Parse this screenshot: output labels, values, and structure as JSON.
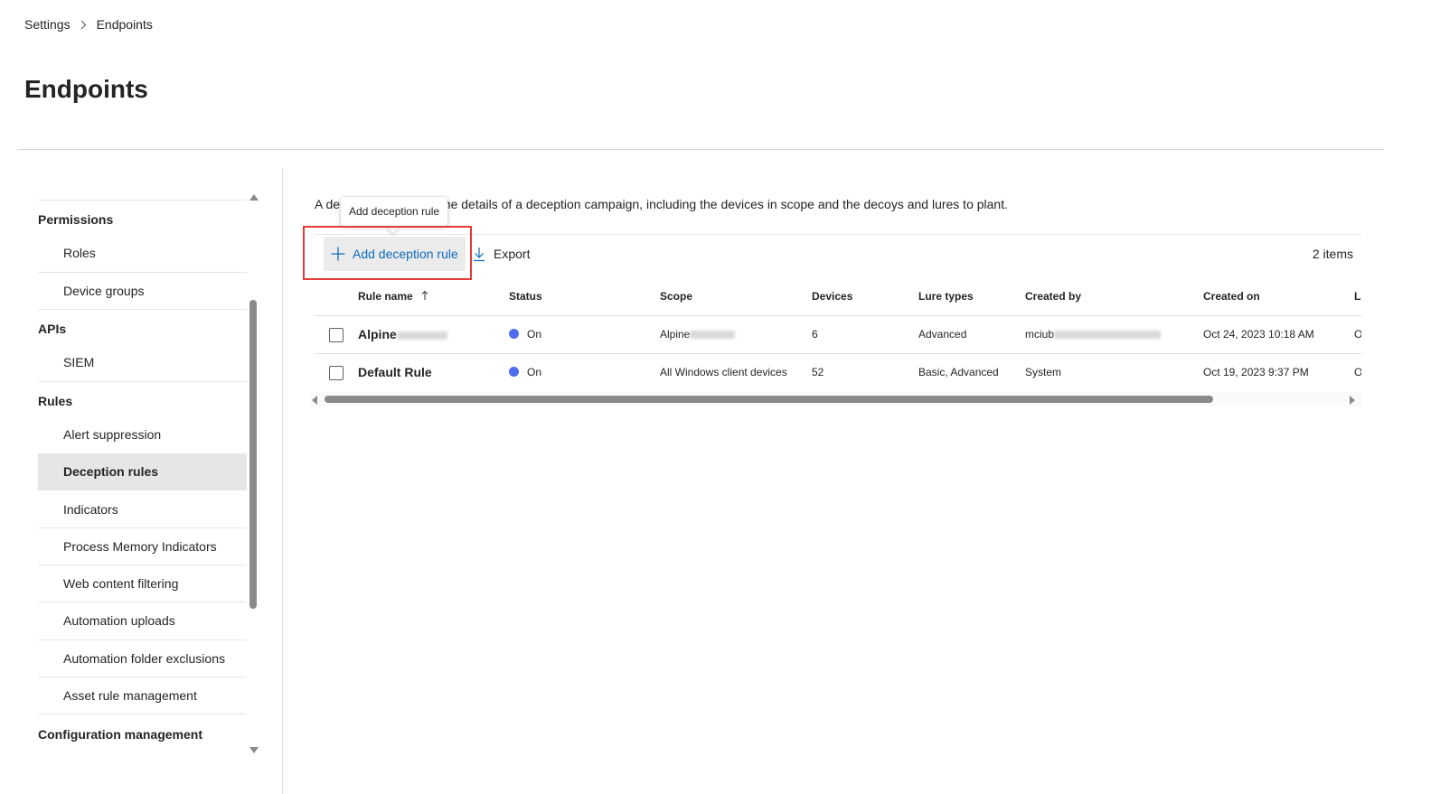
{
  "breadcrumb": {
    "items": [
      "Settings",
      "Endpoints"
    ]
  },
  "page": {
    "title": "Endpoints"
  },
  "sidebar": {
    "sections": [
      {
        "header": "Permissions",
        "items": [
          "Roles",
          "Device groups"
        ]
      },
      {
        "header": "APIs",
        "items": [
          "SIEM"
        ]
      },
      {
        "header": "Rules",
        "items": [
          "Alert suppression",
          "Deception rules",
          "Indicators",
          "Process Memory Indicators",
          "Web content filtering",
          "Automation uploads",
          "Automation folder exclusions",
          "Asset rule management"
        ]
      },
      {
        "header": "Configuration management",
        "items": []
      }
    ],
    "selected_item": "Deception rules"
  },
  "content": {
    "description_prefix": "A de",
    "description_suffix": "s the details of a deception campaign, including the devices in scope and the decoys and lures to plant.",
    "tooltip": "Add deception rule",
    "toolbar": {
      "add_label": "Add deception rule",
      "add_icon": "plus-icon",
      "export_label": "Export",
      "export_icon": "download-icon",
      "item_count": "2 items"
    },
    "table": {
      "columns": [
        "Rule name",
        "Status",
        "Scope",
        "Devices",
        "Lure types",
        "Created by",
        "Created on",
        "La"
      ],
      "sort_icon": "arrow-up-icon",
      "rows": [
        {
          "name": "Alpine",
          "status": "On",
          "scope": "Alpine",
          "devices": "6",
          "lure_types": "Advanced",
          "created_by": "mciub",
          "created_on": "Oct 24, 2023 10:18 AM",
          "last": "O"
        },
        {
          "name": "Default Rule",
          "status": "On",
          "scope": "All Windows client devices",
          "devices": "52",
          "lure_types": "Basic, Advanced",
          "created_by": "System",
          "created_on": "Oct 19, 2023 9:37 PM",
          "last": "O"
        }
      ]
    }
  },
  "colors": {
    "accent": "#0f6cbd",
    "status_on": "#4f6bed",
    "highlight": "#e53935"
  }
}
